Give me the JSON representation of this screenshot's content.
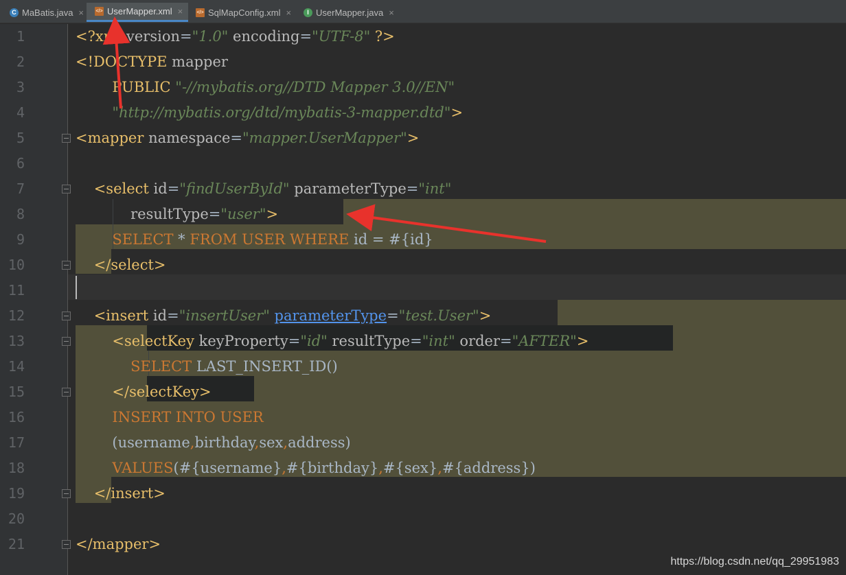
{
  "tabs": [
    {
      "label": "MaBatis.java",
      "icon": "java-class-icon",
      "active": false
    },
    {
      "label": "UserMapper.xml",
      "icon": "xml-file-icon",
      "active": true
    },
    {
      "label": "SqlMapConfig.xml",
      "icon": "xml-file-icon",
      "active": false
    },
    {
      "label": "UserMapper.java",
      "icon": "java-interface-icon",
      "active": false
    }
  ],
  "line_numbers": [
    "1",
    "2",
    "3",
    "4",
    "5",
    "6",
    "7",
    "8",
    "9",
    "10",
    "11",
    "12",
    "13",
    "14",
    "15",
    "16",
    "17",
    "18",
    "19",
    "20",
    "21"
  ],
  "code_lines": [
    [
      [
        "tag",
        "<?xml "
      ],
      [
        "attr",
        "version"
      ],
      [
        "plain",
        "="
      ],
      [
        "str",
        "\"1.0\""
      ],
      [
        "attr",
        " encoding"
      ],
      [
        "plain",
        "="
      ],
      [
        "str",
        "\"UTF-8\""
      ],
      [
        "tag",
        " ?>"
      ]
    ],
    [
      [
        "tag",
        "<!DOCTYPE "
      ],
      [
        "attr",
        "mapper"
      ]
    ],
    [
      [
        "plain",
        "        "
      ],
      [
        "tag",
        "PUBLIC "
      ],
      [
        "str",
        "\"-//mybatis.org//DTD Mapper 3.0//EN\""
      ]
    ],
    [
      [
        "plain",
        "        "
      ],
      [
        "str",
        "\"http://mybatis.org/dtd/mybatis-3-mapper.dtd\""
      ],
      [
        "tag",
        ">"
      ]
    ],
    [
      [
        "tag",
        "<mapper "
      ],
      [
        "attr",
        "namespace"
      ],
      [
        "plain",
        "="
      ],
      [
        "str",
        "\"mapper.UserMapper\""
      ],
      [
        "tag",
        ">"
      ]
    ],
    [],
    [
      [
        "plain",
        "    "
      ],
      [
        "tag",
        "<select "
      ],
      [
        "attr",
        "id"
      ],
      [
        "plain",
        "="
      ],
      [
        "str",
        "\"findUserById\""
      ],
      [
        "attr",
        " parameterType"
      ],
      [
        "plain",
        "="
      ],
      [
        "str",
        "\"int\""
      ]
    ],
    [
      [
        "plain",
        "            "
      ],
      [
        "attr",
        "resultType"
      ],
      [
        "plain",
        "="
      ],
      [
        "str",
        "\"user\""
      ],
      [
        "tag",
        ">"
      ]
    ],
    [
      [
        "plain",
        "        "
      ],
      [
        "kw",
        "SELECT "
      ],
      [
        "plain",
        "* "
      ],
      [
        "kw",
        "FROM USER WHERE "
      ],
      [
        "plain",
        "id = #{id}"
      ]
    ],
    [
      [
        "plain",
        "    "
      ],
      [
        "tag",
        "</select>"
      ]
    ],
    [],
    [
      [
        "plain",
        "    "
      ],
      [
        "tag",
        "<insert "
      ],
      [
        "attr",
        "id"
      ],
      [
        "plain",
        "="
      ],
      [
        "str",
        "\"insertUser\" "
      ],
      [
        "link",
        "parameterType"
      ],
      [
        "plain",
        "="
      ],
      [
        "str",
        "\"test.User\""
      ],
      [
        "tag",
        ">"
      ]
    ],
    [
      [
        "plain",
        "        "
      ],
      [
        "tag",
        "<selectKey "
      ],
      [
        "attr",
        "keyProperty"
      ],
      [
        "plain",
        "="
      ],
      [
        "str",
        "\"id\""
      ],
      [
        "attr",
        " resultType"
      ],
      [
        "plain",
        "="
      ],
      [
        "str",
        "\"int\""
      ],
      [
        "attr",
        " order"
      ],
      [
        "plain",
        "="
      ],
      [
        "str",
        "\"AFTER\""
      ],
      [
        "tag",
        ">"
      ]
    ],
    [
      [
        "plain",
        "            "
      ],
      [
        "kw",
        "SELECT "
      ],
      [
        "plain",
        "LAST_INSERT_ID()"
      ]
    ],
    [
      [
        "plain",
        "        "
      ],
      [
        "tag",
        "</selectKey>"
      ]
    ],
    [
      [
        "plain",
        "        "
      ],
      [
        "kw",
        "INSERT INTO USER"
      ]
    ],
    [
      [
        "plain",
        "        (username"
      ],
      [
        "kw",
        ","
      ],
      [
        "plain",
        "birthday"
      ],
      [
        "kw",
        ","
      ],
      [
        "plain",
        "sex"
      ],
      [
        "kw",
        ","
      ],
      [
        "plain",
        "address)"
      ]
    ],
    [
      [
        "plain",
        "        "
      ],
      [
        "kw",
        "VALUES"
      ],
      [
        "plain",
        "(#{username}"
      ],
      [
        "kw",
        ","
      ],
      [
        "plain",
        "#{birthday}"
      ],
      [
        "kw",
        ","
      ],
      [
        "plain",
        "#{sex}"
      ],
      [
        "kw",
        ","
      ],
      [
        "plain",
        "#{address})"
      ]
    ],
    [
      [
        "plain",
        "    "
      ],
      [
        "tag",
        "</insert>"
      ]
    ],
    [],
    [
      [
        "tag",
        "</mapper>"
      ]
    ]
  ],
  "watermark": "https://blog.csdn.net/qq_29951983",
  "colors": {
    "background": "#2b2b2b",
    "gutter": "#313335",
    "tag": "#e8bf6a",
    "string": "#6a8759",
    "keyword": "#cc7832",
    "highlight": "#52503a",
    "annotation_arrow": "#e8322c"
  }
}
